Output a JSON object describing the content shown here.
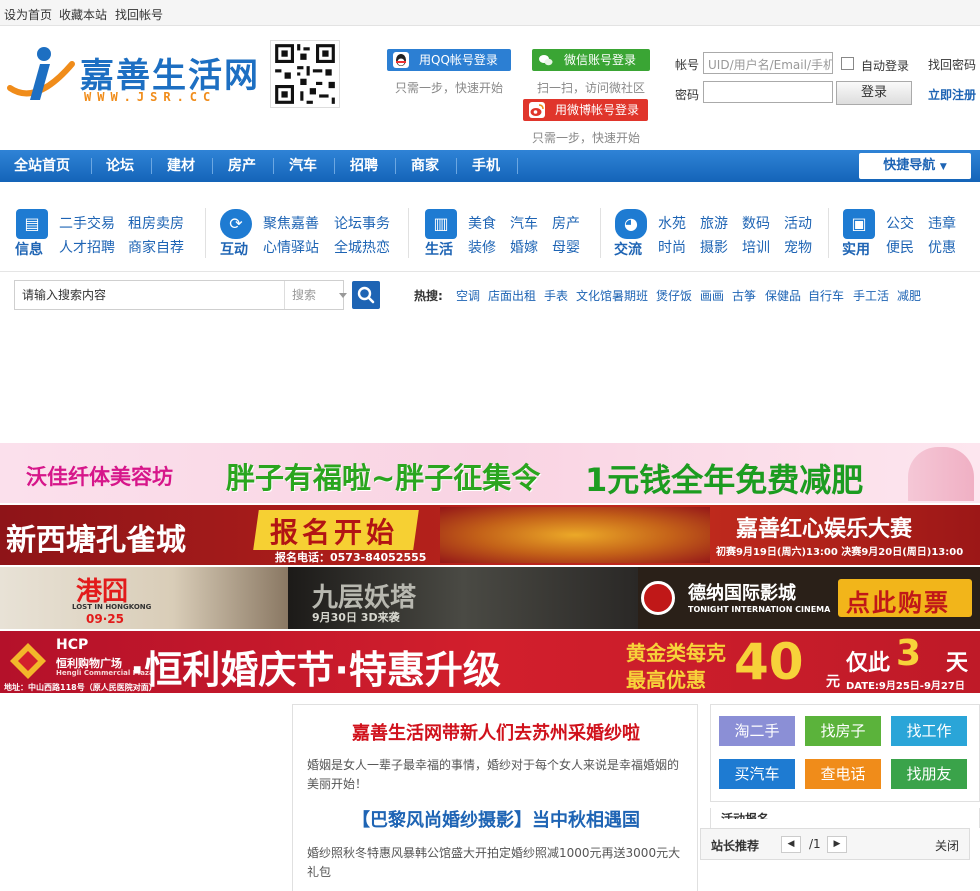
{
  "topbar": {
    "set_home": "设为首页",
    "bookmark": "收藏本站",
    "find_account": "找回帐号"
  },
  "header": {
    "logo_text": "嘉善生活网",
    "logo_url": "WWW.JSR.CC",
    "qq_login": "用QQ帐号登录",
    "qq_tip": "只需一步，快速开始",
    "wechat_login": "微信账号登录",
    "wechat_tip": "扫一扫，访问微社区",
    "weibo_login": "用微博帐号登录",
    "weibo_tip": "只需一步，快速开始",
    "account_label": "帐号",
    "account_placeholder": "UID/用户名/Email/手机号",
    "password_label": "密码",
    "auto_login": "自动登录",
    "find_password": "找回密码",
    "login_button": "登录",
    "register": "立即注册"
  },
  "nav": {
    "items": [
      "全站首页",
      "论坛",
      "建材",
      "房产",
      "汽车",
      "招聘",
      "商家",
      "手机"
    ],
    "quick_nav": "快捷导航"
  },
  "categories": [
    {
      "name": "信息",
      "icon": "info-doc-icon",
      "links": [
        "二手交易",
        "租房卖房",
        "人才招聘",
        "商家自荐"
      ]
    },
    {
      "name": "互动",
      "icon": "refresh-cycle-icon",
      "links": [
        "聚焦嘉善",
        "论坛事务",
        "心情驿站",
        "全城热恋"
      ]
    },
    {
      "name": "生活",
      "icon": "building-icon",
      "links": [
        "美食",
        "汽车",
        "房产",
        "装修",
        "婚嫁",
        "母婴"
      ]
    },
    {
      "name": "交流",
      "icon": "chat-bubble-icon",
      "links": [
        "水苑",
        "旅游",
        "数码",
        "活动",
        "时尚",
        "摄影",
        "培训",
        "宠物"
      ]
    },
    {
      "name": "实用",
      "icon": "toolbox-icon",
      "links": [
        "公交",
        "违章",
        "便民",
        "优惠"
      ]
    }
  ],
  "search": {
    "placeholder": "请输入搜索内容",
    "type": "搜索",
    "hot_label": "热搜:",
    "hot": [
      "空调",
      "店面出租",
      "手表",
      "文化馆暑期班",
      "煲仔饭",
      "画画",
      "古筝",
      "保健品",
      "自行车",
      "手工活",
      "减肥"
    ]
  },
  "banners": {
    "b1": {
      "shop": "沃佳纤体美容坊",
      "slogan": "胖子有福啦~胖子征集令",
      "offer": "1元钱全年免费减肥"
    },
    "b2": {
      "left": "新西塘孔雀城",
      "mid": "报名开始",
      "phone": "报名电话：0573-84052555",
      "right": "嘉善红心娱乐大赛",
      "dates": "初赛9月19日(周六)13:00 决赛9月20日(周日)13:00"
    },
    "b3": {
      "movie": "港囧",
      "movie_en": "LOST IN HONGKONG",
      "movie_date": "09·25",
      "movie2": "九层妖塔",
      "movie2_date": "9月30日 3D来袭",
      "cinema": "德纳国际影城",
      "cinema_en": "TONIGHT INTERNATION CINEMA",
      "cta": "点此购票"
    },
    "b4": {
      "brand": "HCP",
      "brand_cn": "恒利购物广场",
      "brand_en": "Hengli Commercial Plaza",
      "address": "地址：中山西路118号（原人民医院对面）",
      "title": "·恒利婚庆节·特惠升级",
      "gold": "黄金类每克",
      "max": "最高优惠",
      "amount": "40",
      "unit": "元",
      "only": "仅此",
      "days": "3",
      "day_unit": "天",
      "dates": "DATE:9月25日-9月27日"
    }
  },
  "articles": [
    {
      "title": "嘉善生活网带新人们去苏州采婚纱啦",
      "desc": "婚姻是女人一辈子最幸福的事情，婚纱对于每个女人来说是幸福婚姻的美丽开始！"
    },
    {
      "title": "【巴黎风尚婚纱摄影】当中秋相遇国",
      "desc": "婚纱照秋冬特惠风暴韩公馆盛大开拍定婚纱照减1000元再送3000元大礼包"
    }
  ],
  "quick_links": [
    "淘二手",
    "找房子",
    "找工作",
    "买汽车",
    "查电话",
    "找朋友"
  ],
  "quick_colors": [
    "#8b8fd6",
    "#5bb33b",
    "#2aa5d8",
    "#1e7bd2",
    "#f08c1a",
    "#3aa34a"
  ],
  "recommend": {
    "title": "站长推荐",
    "page": "/1",
    "close": "关闭",
    "cut_title": "活动报名"
  },
  "colors": {
    "brand_blue": "#1e64b4",
    "nav_blue": "#1a6fc7",
    "title_red": "#d0111b"
  }
}
